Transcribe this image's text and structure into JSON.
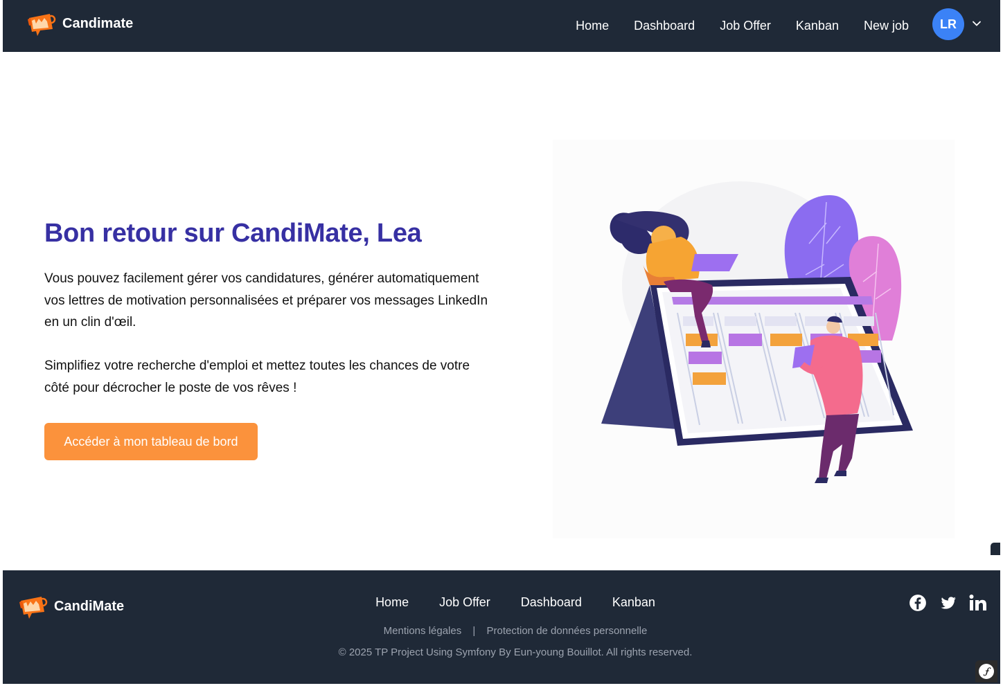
{
  "header": {
    "brand": "Candimate",
    "nav": [
      {
        "label": "Home",
        "name": "nav-home"
      },
      {
        "label": "Dashboard",
        "name": "nav-dashboard"
      },
      {
        "label": "Job Offer",
        "name": "nav-job-offer"
      },
      {
        "label": "Kanban",
        "name": "nav-kanban"
      },
      {
        "label": "New job",
        "name": "nav-new-job"
      }
    ],
    "user_initials": "LR",
    "avatar_color": "#3b82f6"
  },
  "hero": {
    "title": "Bon retour sur CandiMate, Lea",
    "paragraph1": "Vous pouvez facilement gérer vos candidatures, générer automatiquement vos lettres de motivation personnalisées et préparer vos messages LinkedIn en un clin d'œil.",
    "paragraph2": "Simplifiez votre recherche d'emploi et mettez toutes les chances de votre côté pour décrocher le poste de vos rêves !",
    "cta_label": "Accéder à mon tableau de bord",
    "cta_color": "#fb923c",
    "title_color": "#3730a3"
  },
  "footer": {
    "brand": "CandiMate",
    "nav": [
      {
        "label": "Home",
        "name": "footer-nav-home"
      },
      {
        "label": "Job Offer",
        "name": "footer-nav-job-offer"
      },
      {
        "label": "Dashboard",
        "name": "footer-nav-dashboard"
      },
      {
        "label": "Kanban",
        "name": "footer-nav-kanban"
      }
    ],
    "legal_mentions": "Mentions légales",
    "separator": "|",
    "privacy": "Protection de données personnelle",
    "copyright": "© 2025 TP Project Using Symfony By Eun-young Bouillot. All rights reserved.",
    "social_icons": [
      "facebook-icon",
      "twitter-icon",
      "linkedin-icon"
    ]
  },
  "colors": {
    "navbar_bg": "#1f2937",
    "accent_orange": "#fb923c"
  }
}
